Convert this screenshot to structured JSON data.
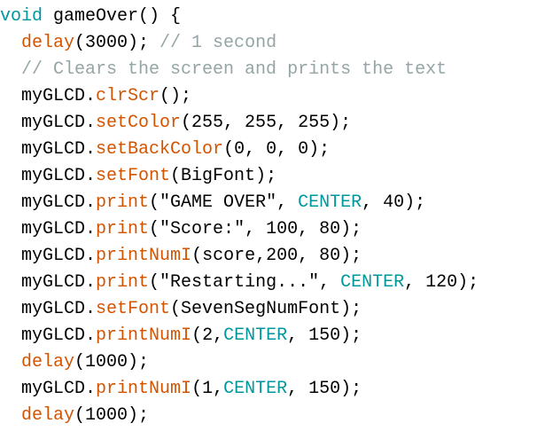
{
  "colors": {
    "keyword": "#00979c",
    "function": "#d35400",
    "comment": "#95a5a6",
    "constant": "#00979c",
    "plain": "#000000",
    "background": "#ffffff"
  },
  "code": {
    "lines": [
      {
        "tokens": [
          {
            "t": "void",
            "k": "kw"
          },
          {
            "t": " gameOver() {",
            "k": "pl"
          }
        ]
      },
      {
        "tokens": [
          {
            "t": "  ",
            "k": "pl"
          },
          {
            "t": "delay",
            "k": "fn"
          },
          {
            "t": "(3000); ",
            "k": "pl"
          },
          {
            "t": "// 1 second",
            "k": "cm"
          }
        ]
      },
      {
        "tokens": [
          {
            "t": "  ",
            "k": "pl"
          },
          {
            "t": "// Clears the screen and prints the text",
            "k": "cm"
          }
        ]
      },
      {
        "tokens": [
          {
            "t": "  myGLCD.",
            "k": "pl"
          },
          {
            "t": "clrScr",
            "k": "fn"
          },
          {
            "t": "();",
            "k": "pl"
          }
        ]
      },
      {
        "tokens": [
          {
            "t": "  myGLCD.",
            "k": "pl"
          },
          {
            "t": "setColor",
            "k": "fn"
          },
          {
            "t": "(255, 255, 255);",
            "k": "pl"
          }
        ]
      },
      {
        "tokens": [
          {
            "t": "  myGLCD.",
            "k": "pl"
          },
          {
            "t": "setBackColor",
            "k": "fn"
          },
          {
            "t": "(0, 0, 0);",
            "k": "pl"
          }
        ]
      },
      {
        "tokens": [
          {
            "t": "  myGLCD.",
            "k": "pl"
          },
          {
            "t": "setFont",
            "k": "fn"
          },
          {
            "t": "(BigFont);",
            "k": "pl"
          }
        ]
      },
      {
        "tokens": [
          {
            "t": "  myGLCD.",
            "k": "pl"
          },
          {
            "t": "print",
            "k": "fn"
          },
          {
            "t": "(\"GAME OVER\", ",
            "k": "pl"
          },
          {
            "t": "CENTER",
            "k": "ct"
          },
          {
            "t": ", 40);",
            "k": "pl"
          }
        ]
      },
      {
        "tokens": [
          {
            "t": "  myGLCD.",
            "k": "pl"
          },
          {
            "t": "print",
            "k": "fn"
          },
          {
            "t": "(\"Score:\", 100, 80);",
            "k": "pl"
          }
        ]
      },
      {
        "tokens": [
          {
            "t": "  myGLCD.",
            "k": "pl"
          },
          {
            "t": "printNumI",
            "k": "fn"
          },
          {
            "t": "(score,200, 80);",
            "k": "pl"
          }
        ]
      },
      {
        "tokens": [
          {
            "t": "  myGLCD.",
            "k": "pl"
          },
          {
            "t": "print",
            "k": "fn"
          },
          {
            "t": "(\"Restarting...\", ",
            "k": "pl"
          },
          {
            "t": "CENTER",
            "k": "ct"
          },
          {
            "t": ", 120);",
            "k": "pl"
          }
        ]
      },
      {
        "tokens": [
          {
            "t": "  myGLCD.",
            "k": "pl"
          },
          {
            "t": "setFont",
            "k": "fn"
          },
          {
            "t": "(SevenSegNumFont);",
            "k": "pl"
          }
        ]
      },
      {
        "tokens": [
          {
            "t": "  myGLCD.",
            "k": "pl"
          },
          {
            "t": "printNumI",
            "k": "fn"
          },
          {
            "t": "(2,",
            "k": "pl"
          },
          {
            "t": "CENTER",
            "k": "ct"
          },
          {
            "t": ", 150);",
            "k": "pl"
          }
        ]
      },
      {
        "tokens": [
          {
            "t": "  ",
            "k": "pl"
          },
          {
            "t": "delay",
            "k": "fn"
          },
          {
            "t": "(1000);",
            "k": "pl"
          }
        ]
      },
      {
        "tokens": [
          {
            "t": "  myGLCD.",
            "k": "pl"
          },
          {
            "t": "printNumI",
            "k": "fn"
          },
          {
            "t": "(1,",
            "k": "pl"
          },
          {
            "t": "CENTER",
            "k": "ct"
          },
          {
            "t": ", 150);",
            "k": "pl"
          }
        ]
      },
      {
        "tokens": [
          {
            "t": "  ",
            "k": "pl"
          },
          {
            "t": "delay",
            "k": "fn"
          },
          {
            "t": "(1000);",
            "k": "pl"
          }
        ]
      }
    ]
  }
}
